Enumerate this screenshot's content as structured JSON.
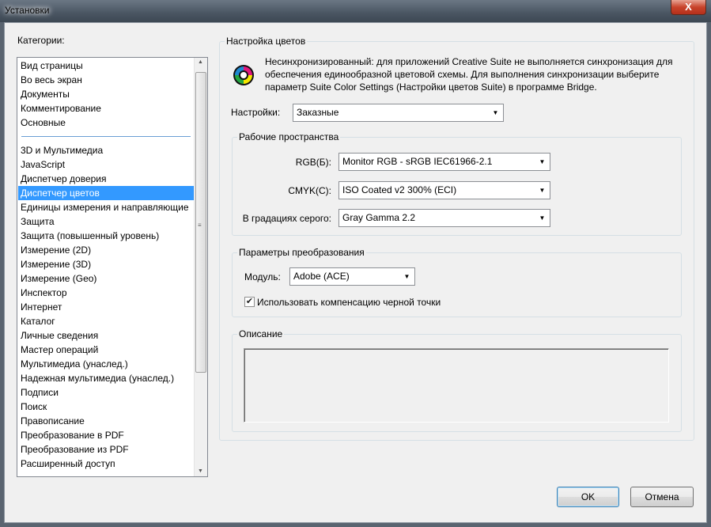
{
  "window": {
    "title": "Установки",
    "close_label": "X"
  },
  "categories": {
    "label": "Категории:",
    "group1": [
      "Вид страницы",
      "Во весь экран",
      "Документы",
      "Комментирование",
      "Основные"
    ],
    "group2": [
      "3D и Мультимедиа",
      "JavaScript",
      "Диспетчер доверия",
      "Диспетчер цветов",
      "Единицы измерения и направляющие",
      "Защита",
      "Защита (повышенный уровень)",
      "Измерение (2D)",
      "Измерение (3D)",
      "Измерение (Geo)",
      "Инспектор",
      "Интернет",
      "Каталог",
      "Личные сведения",
      "Мастер операций",
      "Мультимедиа (унаслед.)",
      "Надежная мультимедиа (унаслед.)",
      "Подписи",
      "Поиск",
      "Правописание",
      "Преобразование в PDF",
      "Преобразование из PDF",
      "Расширенный доступ"
    ],
    "selected": "Диспетчер цветов"
  },
  "color_settings": {
    "title": "Настройка цветов",
    "icon": "color-wheel-icon",
    "message": [
      "Несинхронизированный: для приложений Creative Suite не выполняется синхронизация для",
      "обеспечения единообразной цветовой схемы. Для выполнения синхронизации выберите",
      "параметр Suite Color Settings (Настройки цветов Suite) в программе Bridge."
    ],
    "settings_label": "Настройки:",
    "settings_value": "Заказные",
    "workspaces": {
      "title": "Рабочие пространства",
      "rgb_label": "RGB(Б):",
      "rgb_value": "Monitor RGB - sRGB IEC61966-2.1",
      "cmyk_label": "CMYK(C):",
      "cmyk_value": "ISO Coated v2 300% (ECI)",
      "gray_label": "В градациях серого:",
      "gray_value": "Gray Gamma 2.2"
    },
    "conversion": {
      "title": "Параметры преобразования",
      "engine_label": "Модуль:",
      "engine_value": "Adobe (ACE)",
      "bpc_label": "Использовать компенсацию черной точки",
      "bpc_checked": true
    },
    "description": {
      "title": "Описание",
      "text": ""
    }
  },
  "buttons": {
    "ok": "OK",
    "cancel": "Отмена"
  }
}
